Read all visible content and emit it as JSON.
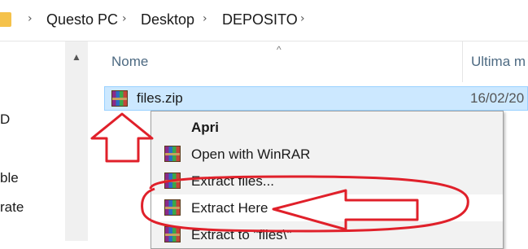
{
  "breadcrumb": {
    "items": [
      "Questo PC",
      "Desktop",
      "DEPOSITO"
    ],
    "separator": "›"
  },
  "navpane": {
    "items": [
      "D",
      "ble",
      "rate"
    ]
  },
  "columns": {
    "name": "Nome",
    "modified": "Ultima m"
  },
  "file": {
    "name": "files.zip",
    "date": "16/02/20"
  },
  "context_menu": {
    "items": [
      {
        "label": "Apri",
        "bold": true,
        "icon": "none"
      },
      {
        "label": "Open with WinRAR",
        "icon": "winrar-icon"
      },
      {
        "label": "Extract files...",
        "icon": "winrar-icon"
      },
      {
        "label": "Extract Here",
        "icon": "winrar-icon"
      },
      {
        "label": "Extract to \"files\\\"",
        "icon": "winrar-icon"
      }
    ]
  },
  "colors": {
    "selection": "#cce8ff",
    "annotation": "#e0202a",
    "menu_bg": "#f2f2f2"
  }
}
